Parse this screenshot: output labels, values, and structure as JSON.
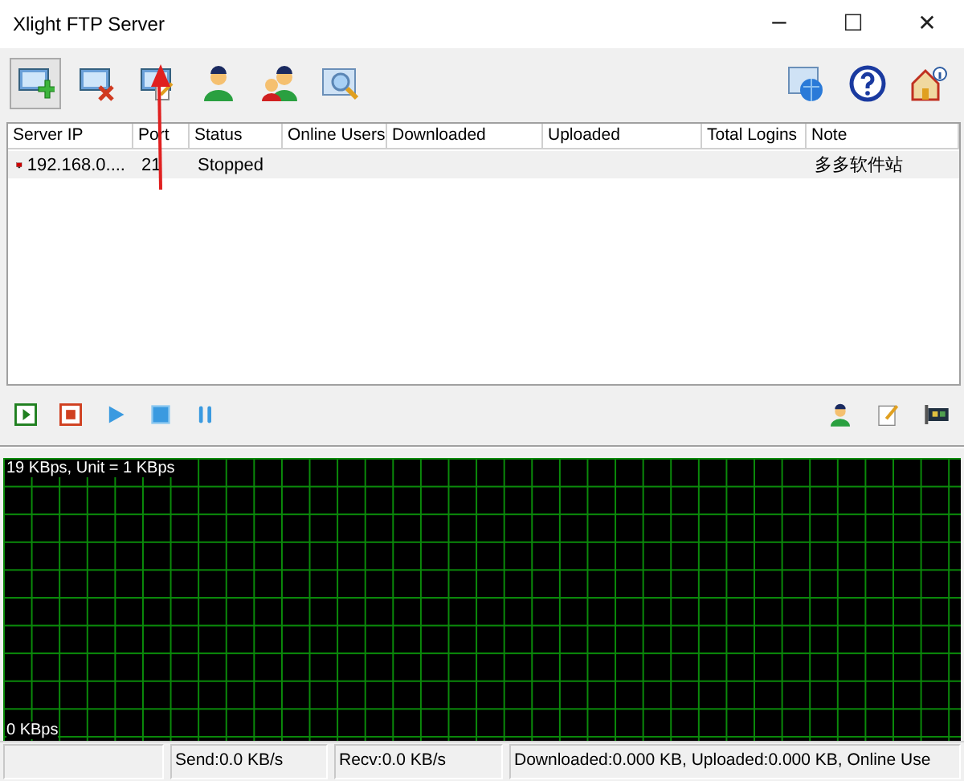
{
  "window": {
    "title": "Xlight FTP Server",
    "controls": [
      "─",
      "☐",
      "✕"
    ]
  },
  "table": {
    "columns": [
      "Server IP",
      "Port",
      "Status",
      "Online Users",
      "Downloaded",
      "Uploaded",
      "Total Logins",
      "Note"
    ],
    "rows": [
      {
        "selected": true,
        "running": false,
        "cells": [
          "192.168.0....",
          "21",
          "Stopped",
          "",
          "",
          "",
          "",
          "多多软件站"
        ]
      }
    ]
  },
  "graph": {
    "top_label": "19 KBps, Unit = 1 KBps",
    "bottom_label": "0 KBps"
  },
  "status_bar": [
    "Send:0.0 KB/s",
    "Recv:0.0 KB/s",
    "Downloaded:0.000 KB, Uploaded:0.000 KB, Online Use"
  ]
}
